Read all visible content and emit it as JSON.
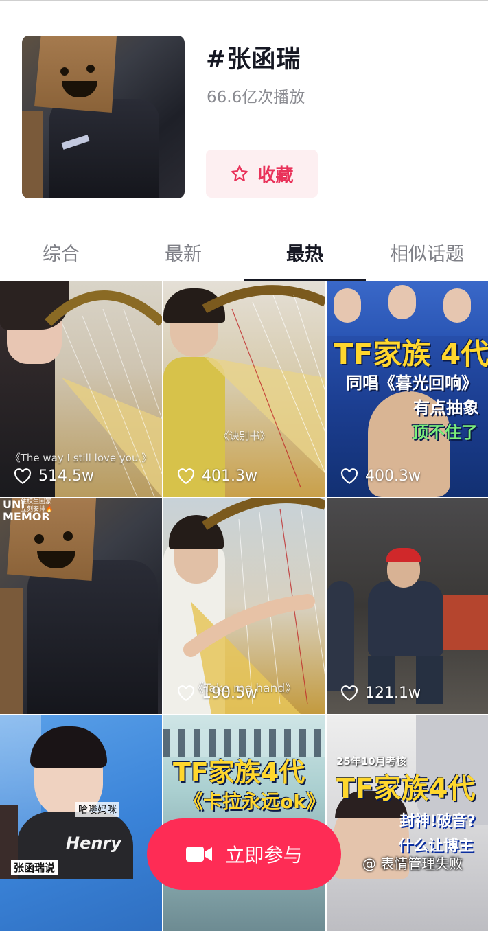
{
  "topic": {
    "title": "#张函瑞",
    "plays": "66.6亿次播放",
    "collect_label": "收藏"
  },
  "tabs": [
    {
      "label": "综合",
      "active": false
    },
    {
      "label": "最新",
      "active": false
    },
    {
      "label": "最热",
      "active": true
    },
    {
      "label": "相似话题",
      "active": false
    }
  ],
  "videos": [
    {
      "likes": "514.5w",
      "caption": "《The way I still love you 》"
    },
    {
      "likes": "401.3w",
      "caption": "《诀别书》"
    },
    {
      "likes": "400.3w",
      "title_lines": [
        "TF家族 4代",
        "同唱《暮光回响》",
        "有点抽象",
        "顶不住了"
      ]
    },
    {
      "likes": "",
      "caption_top": [
        "住校生回家",
        "立刻安排🔥"
      ],
      "shirt_text": [
        "UNI",
        "MEMOR"
      ]
    },
    {
      "likes": "190.5w",
      "caption": "《Take me hand》"
    },
    {
      "likes": "121.1w"
    },
    {
      "caption": "哈喽妈咪",
      "tag": "张函瑞说",
      "shirt_text": "Henry"
    },
    {
      "title_lines": [
        "TF家族4代",
        "《卡拉永远ok》"
      ]
    },
    {
      "header": "25年10月考核",
      "title_lines": [
        "TF家族4代",
        "封神!破音?",
        "什么让博主",
        "表情管理失败"
      ]
    }
  ],
  "cta_label": "立即参与",
  "watermark": "@ 表情管理失败",
  "colors": {
    "accent": "#fe2c55",
    "collect_bg": "#fdeff1",
    "collect_text": "#e9325a"
  }
}
